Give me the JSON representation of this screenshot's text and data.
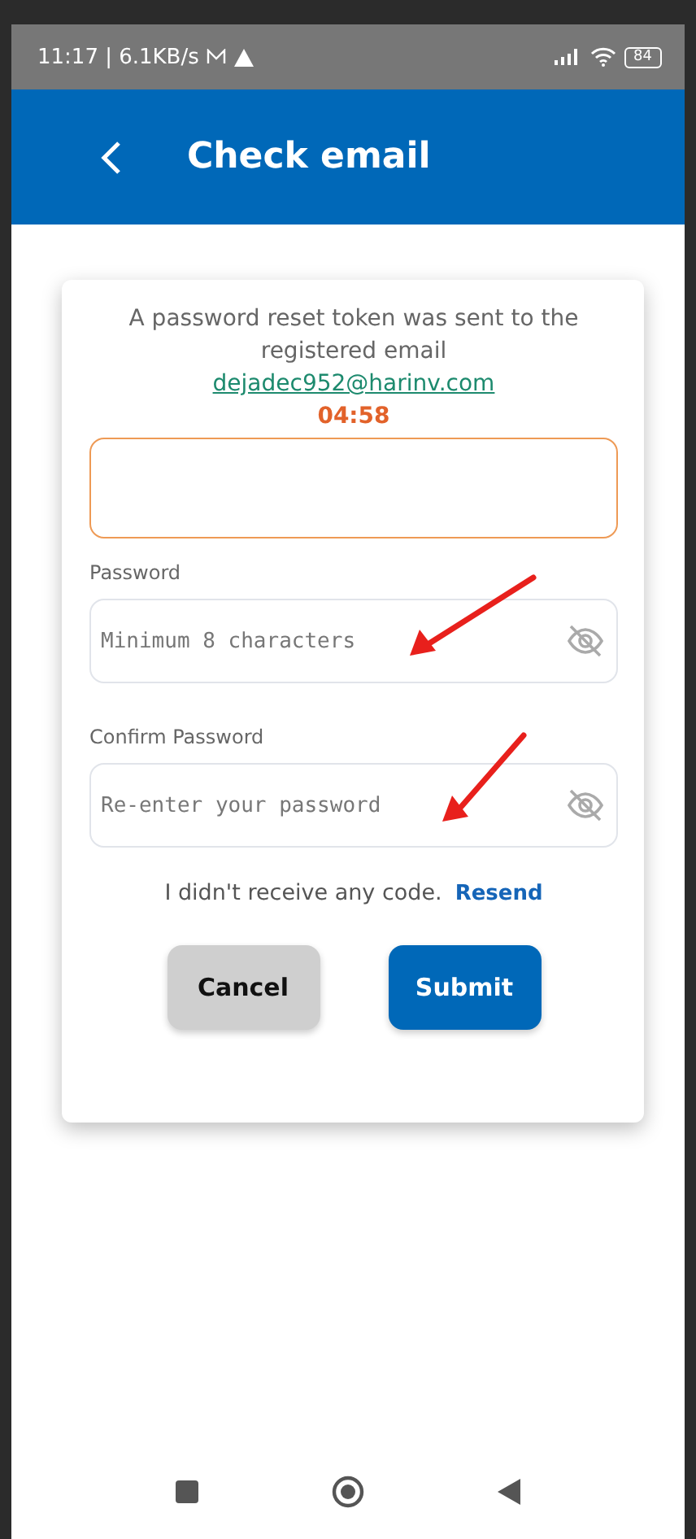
{
  "status_bar": {
    "time": "11:17 | 6.1KB/s",
    "battery": "84"
  },
  "header": {
    "title": "Check email"
  },
  "message": {
    "text": "A password reset token was sent to the registered email",
    "email": "dejadec952@harinv.com",
    "timer": "04:58"
  },
  "code_field": {
    "focused": true
  },
  "fields": [
    {
      "label": "Password",
      "placeholder": "Minimum 8 characters"
    },
    {
      "label": "Confirm Password",
      "placeholder": "Re-enter your password"
    }
  ],
  "resend": {
    "text": "I didn't receive any code.",
    "link": "Resend"
  },
  "buttons": [
    {
      "label": "Cancel",
      "kind": "secondary"
    },
    {
      "label": "Submit",
      "kind": "primary"
    }
  ]
}
